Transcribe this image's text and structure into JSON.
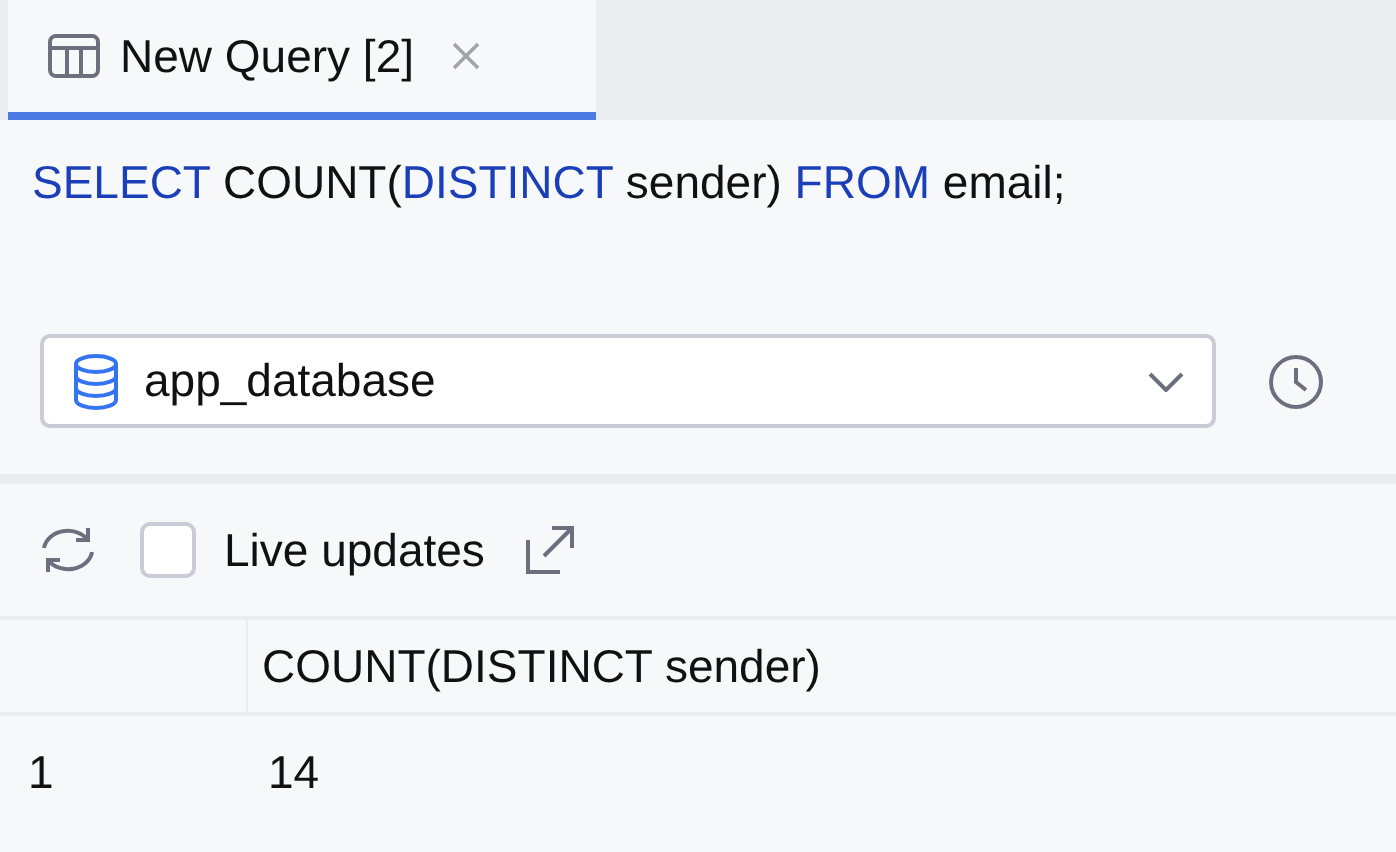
{
  "tabs": [
    {
      "label": "New Query [2]",
      "selected": true
    }
  ],
  "query": [
    {
      "text": "SELECT",
      "kind": "keyword"
    },
    {
      "text": " COUNT(",
      "kind": "plain"
    },
    {
      "text": "DISTINCT",
      "kind": "keyword"
    },
    {
      "text": " sender) ",
      "kind": "plain"
    },
    {
      "text": "FROM",
      "kind": "keyword"
    },
    {
      "text": " email;",
      "kind": "plain"
    }
  ],
  "database_select": {
    "value": "app_database"
  },
  "toolbar": {
    "live_updates": {
      "label": "Live updates",
      "checked": false
    }
  },
  "table": {
    "columns": [
      "COUNT(DISTINCT sender)"
    ],
    "rows": [
      {
        "number": "1",
        "cells": [
          "14"
        ]
      }
    ]
  }
}
